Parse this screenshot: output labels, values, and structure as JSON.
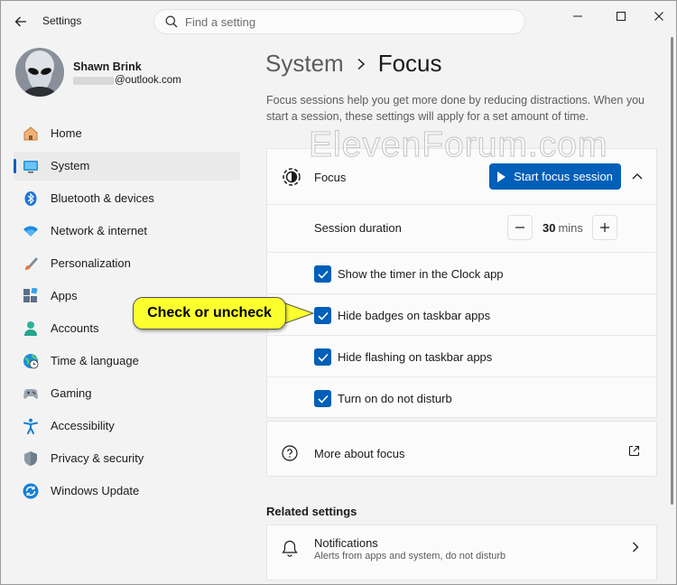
{
  "titlebar": {
    "app_title": "Settings",
    "search_placeholder": "Find a setting"
  },
  "account": {
    "name": "Shawn Brink",
    "email": "@outlook.com"
  },
  "nav": {
    "items": [
      {
        "label": "Home",
        "icon": "home-icon"
      },
      {
        "label": "System",
        "icon": "system-icon",
        "selected": true
      },
      {
        "label": "Bluetooth & devices",
        "icon": "bluetooth-icon"
      },
      {
        "label": "Network & internet",
        "icon": "wifi-icon"
      },
      {
        "label": "Personalization",
        "icon": "brush-icon"
      },
      {
        "label": "Apps",
        "icon": "apps-icon"
      },
      {
        "label": "Accounts",
        "icon": "accounts-icon"
      },
      {
        "label": "Time & language",
        "icon": "globe-clock-icon"
      },
      {
        "label": "Gaming",
        "icon": "gamepad-icon"
      },
      {
        "label": "Accessibility",
        "icon": "accessibility-icon"
      },
      {
        "label": "Privacy & security",
        "icon": "shield-icon"
      },
      {
        "label": "Windows Update",
        "icon": "update-icon"
      }
    ]
  },
  "breadcrumb": {
    "parent": "System",
    "current": "Focus"
  },
  "description": "Focus sessions help you get more done by reducing distractions. When you start a session, these settings will apply for a set amount of time.",
  "focus_card": {
    "title": "Focus",
    "start_button": "Start focus session",
    "session_duration_label": "Session duration",
    "duration_value": "30",
    "duration_unit": "mins",
    "options": [
      {
        "label": "Show the timer in the Clock app",
        "checked": true
      },
      {
        "label": "Hide badges on taskbar apps",
        "checked": true
      },
      {
        "label": "Hide flashing on taskbar apps",
        "checked": true
      },
      {
        "label": "Turn on do not disturb",
        "checked": true
      }
    ]
  },
  "more_card": {
    "label": "More about focus"
  },
  "related": {
    "title": "Related settings",
    "notifications_title": "Notifications",
    "notifications_subtitle": "Alerts from apps and system, do not disturb"
  },
  "watermark": "ElevenForum.com",
  "callout": "Check or uncheck",
  "colors": {
    "accent": "#005fb8",
    "callout_fill": "#fbff2e",
    "window_bg": "#f3f3f3",
    "card_bg": "#fbfbfb"
  }
}
